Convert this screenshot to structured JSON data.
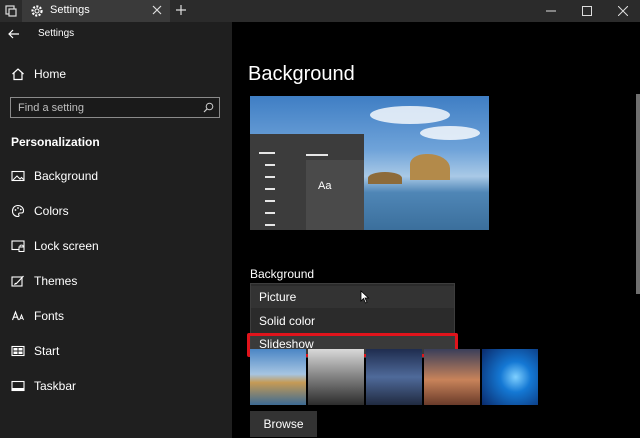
{
  "window": {
    "tab_title": "Settings"
  },
  "sidebar": {
    "app_title": "Settings",
    "home_label": "Home",
    "search_placeholder": "Find a setting",
    "section_title": "Personalization",
    "items": [
      {
        "label": "Background",
        "icon": "picture-icon"
      },
      {
        "label": "Colors",
        "icon": "palette-icon"
      },
      {
        "label": "Lock screen",
        "icon": "lock-screen-icon"
      },
      {
        "label": "Themes",
        "icon": "brush-icon"
      },
      {
        "label": "Fonts",
        "icon": "font-icon"
      },
      {
        "label": "Start",
        "icon": "start-icon"
      },
      {
        "label": "Taskbar",
        "icon": "taskbar-icon"
      }
    ]
  },
  "main": {
    "page_title": "Background",
    "preview_sample_text": "Aa",
    "background_label": "Background",
    "dropdown_options": [
      "Picture",
      "Solid color",
      "Slideshow"
    ],
    "highlighted_option": "Slideshow",
    "browse_label": "Browse"
  },
  "colors": {
    "highlight": "#e0141c",
    "sidebar_bg": "#1f1f1f",
    "content_bg": "#000000"
  }
}
